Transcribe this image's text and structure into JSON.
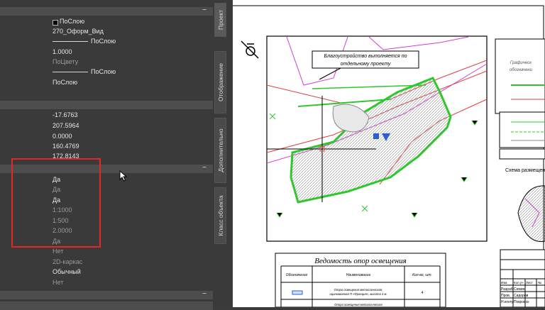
{
  "properties": {
    "general": {
      "color_value": "ПоСлою",
      "layer_value": "270_Оформ_Вид",
      "linetype_value": "ПоСлою",
      "linetype_scale": "1.0000",
      "plot_style": "ПоЦвету",
      "lineweight_value": "ПоСлою",
      "transparency": "ПоСлою"
    },
    "geometry": {
      "values": [
        "-17.6763",
        "207.5964",
        "0.0000",
        "160.4769",
        "172.8143"
      ]
    },
    "misc": {
      "values": [
        "Да",
        "Да",
        "Да",
        "1:1000",
        "1:500",
        "2.0000",
        "Да",
        "Нет",
        "2D-каркас",
        "Обычный",
        "Нет"
      ]
    },
    "collapse_symbol": "−"
  },
  "side_tabs": [
    "Проект",
    "Отображение",
    "Дополнительно",
    "Класс объекта"
  ],
  "drawing": {
    "callout": "Благоустройство выполняется по отдельному проекту",
    "table_title": "Ведомость опор освещения",
    "table_headers": [
      "Обозначение",
      "Наименование",
      "Кол-во, шт."
    ],
    "table_rows": [
      {
        "name": "Опора освещения металлическая, оцинкованная П «Франция», высота 4 м.",
        "qty": "4"
      },
      {
        "name": "Опора освещения металлическая",
        "qty": ""
      }
    ],
    "scheme_caption": "Схема размещения",
    "legend_title": "Графическ обозначени",
    "stamp": {
      "headers": [
        "Изм.",
        "Кол.уч",
        "Лист",
        "№"
      ],
      "rows": [
        [
          "Разраб",
          "Семин"
        ],
        [
          "Пров.",
          "Сидоров"
        ],
        [
          "Н.контр",
          "Покровск"
        ]
      ]
    },
    "colors": {
      "green": "#2ec82e",
      "blue": "#2a5fd6",
      "red": "#e04040",
      "magenta": "#d43cd4"
    }
  }
}
